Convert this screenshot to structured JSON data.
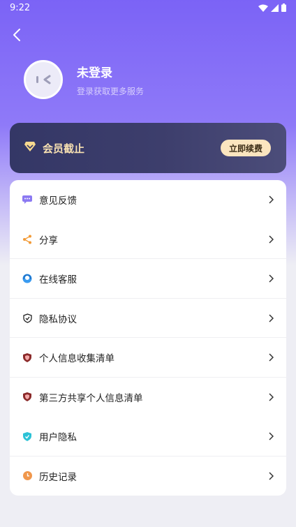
{
  "status_bar": {
    "time": "9:22"
  },
  "profile": {
    "name": "未登录",
    "subtitle": "登录获取更多服务"
  },
  "vip": {
    "title": "会员截止",
    "renew_label": "立即续费"
  },
  "menu": [
    {
      "label": "意见反馈",
      "icon": "feedback-icon"
    },
    {
      "label": "分享",
      "icon": "share-icon"
    },
    {
      "label": "在线客服",
      "icon": "customer-service-icon"
    },
    {
      "label": "隐私协议",
      "icon": "privacy-shield-icon"
    },
    {
      "label": "个人信息收集清单",
      "icon": "info-collection-icon"
    },
    {
      "label": "第三方共享个人信息清单",
      "icon": "third-party-share-icon"
    },
    {
      "label": "用户隐私",
      "icon": "user-privacy-icon"
    },
    {
      "label": "历史记录",
      "icon": "history-icon"
    }
  ],
  "colors": {
    "header_purple": "#7b63f6",
    "vip_gold": "#f8e1b2",
    "vip_card": "#343766"
  }
}
